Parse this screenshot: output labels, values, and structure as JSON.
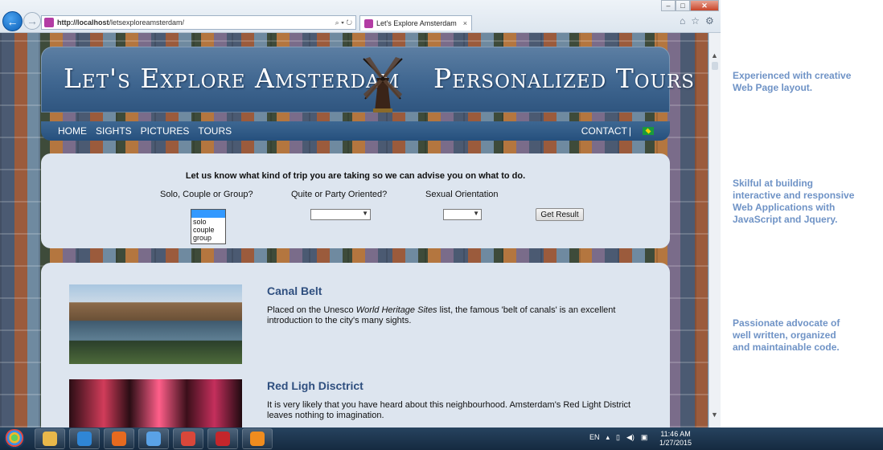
{
  "browser": {
    "url_host": "http://localhost",
    "url_path": "/letsexploreamsterdam/",
    "tab_title": "Let's Explore Amsterdam",
    "address_controls": "⌕ ▾ ↻",
    "tab_close": "×"
  },
  "site": {
    "header_left": "Let's Explore Amsterdam",
    "header_right": "Personalized Tours",
    "nav": [
      "HOME",
      "SIGHTS",
      "PICTURES",
      "TOURS"
    ],
    "contact": "CONTACT",
    "nav_divider": "|",
    "form": {
      "heading": "Let us know what kind of trip you are taking so we can advise you on what to do.",
      "q1": "Solo, Couple or Group?",
      "q2": "Quite or Party Oriented?",
      "q3": "Sexual Orientation",
      "listbox_options": [
        "",
        "solo",
        "couple",
        "group"
      ],
      "select2_value": "",
      "select3_value": "",
      "button": "Get Result"
    },
    "sights": [
      {
        "title": "Canal Belt",
        "text_before": "Placed on the Unesco ",
        "text_italic": "World Heritage Sites",
        "text_after": " list, the famous 'belt of canals' is an excellent introduction to the city's many sights."
      },
      {
        "title": "Red Ligh Disctrict",
        "text": "It is very likely that you have heard about this neighbourhood. Amsterdam's Red Light District leaves nothing to imagination."
      }
    ]
  },
  "side_notes": [
    [
      "Experienced with creative",
      "Web Page layout."
    ],
    [
      "Skilful at building",
      "interactive and responsive",
      "Web Applications with",
      "JavaScript and Jquery."
    ],
    [
      "Passionate advocate of",
      "well written, organized",
      "and maintainable code."
    ]
  ],
  "taskbar": {
    "lang": "EN",
    "time": "11:46 AM",
    "date": "1/27/2015",
    "tray_icons": [
      "▴",
      "▯",
      "◀)",
      "▣"
    ],
    "apps": [
      "file-explorer-icon",
      "internet-explorer-icon",
      "firefox-icon",
      "safari-icon",
      "chrome-icon",
      "filezilla-icon",
      "xampp-icon"
    ],
    "app_colors": [
      "#e9b84a",
      "#2f86d6",
      "#e66a1f",
      "#5aa2e6",
      "#d9473a",
      "#c4262b",
      "#f08c1e"
    ]
  },
  "window_controls": {
    "minimize": "–",
    "maximize": "□",
    "close": "✕"
  },
  "toolbar_icons": [
    "⌂",
    "☆",
    "⚙"
  ]
}
